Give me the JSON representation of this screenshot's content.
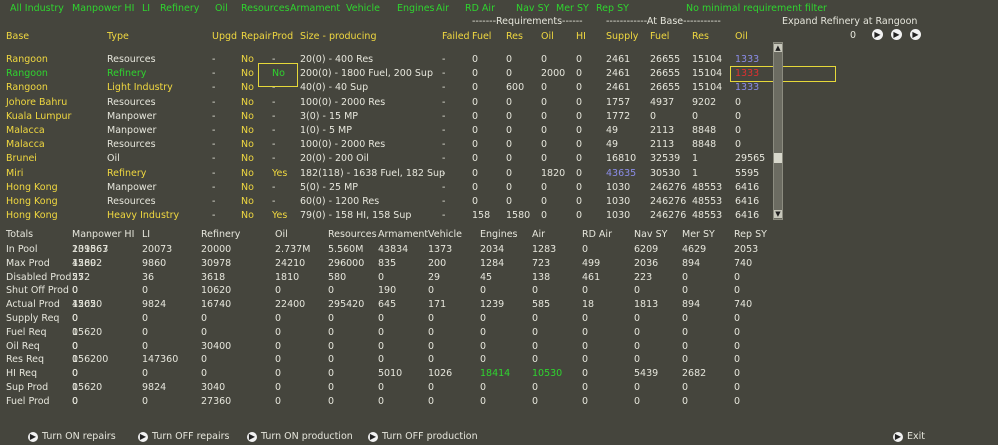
{
  "filters": [
    "All Industry",
    "Manpower HI",
    "LI",
    "Refinery",
    "Oil",
    "Resources",
    "Armament",
    "Vehicle",
    "Engines",
    "Air",
    "RD Air",
    "Nav SY",
    "Mer SY",
    "Rep SY"
  ],
  "filter_note": "No minimal requirement filter",
  "requirements_group": "-------Requirements------",
  "atbase_group": "------------At Base-----------",
  "expand_label": "Expand Refinery at Rangoon",
  "expand_value": "0",
  "columns": [
    "Base",
    "Type",
    "Upgd",
    "Repair",
    "Prod",
    "Size - producing",
    "Failed",
    "Fuel",
    "Res",
    "Oil",
    "HI",
    "Supply",
    "Fuel",
    "Res",
    "Oil"
  ],
  "rows": [
    {
      "base": "Rangoon",
      "type": "Resources",
      "upgd": "-",
      "repair": "No",
      "prod": "-",
      "size": "20(0) - 400 Res",
      "failed": "-",
      "fuel": "0",
      "res": "0",
      "oil": "0",
      "hi": "0",
      "supply": "2461",
      "abfuel": "26655",
      "abres": "15104",
      "aboil": "1333",
      "cb": "yel",
      "ct": "wht",
      "cr": "yel",
      "cp": "wht",
      "cs": "blu"
    },
    {
      "base": "Rangoon",
      "type": "Refinery",
      "upgd": "-",
      "repair": "No",
      "prod": "No",
      "size": "200(0) - 1800 Fuel, 200 Sup",
      "failed": "-",
      "fuel": "0",
      "res": "0",
      "oil": "2000",
      "hi": "0",
      "supply": "2461",
      "abfuel": "26655",
      "abres": "15104",
      "aboil": "1333",
      "cb": "grn",
      "ct": "grn",
      "cr": "yel",
      "cp": "grn",
      "cs": "red"
    },
    {
      "base": "Rangoon",
      "type": "Light Industry",
      "upgd": "-",
      "repair": "No",
      "prod": "-",
      "size": "40(0) - 40 Sup",
      "failed": "-",
      "fuel": "0",
      "res": "600",
      "oil": "0",
      "hi": "0",
      "supply": "2461",
      "abfuel": "26655",
      "abres": "15104",
      "aboil": "1333",
      "cb": "yel",
      "ct": "yel",
      "cr": "yel",
      "cp": "wht",
      "cs": "blu"
    },
    {
      "base": "Johore Bahru",
      "type": "Resources",
      "upgd": "-",
      "repair": "No",
      "prod": "-",
      "size": "100(0) - 2000 Res",
      "failed": "-",
      "fuel": "0",
      "res": "0",
      "oil": "0",
      "hi": "0",
      "supply": "1757",
      "abfuel": "4937",
      "abres": "9202",
      "aboil": "0",
      "cb": "yel",
      "ct": "wht",
      "cr": "yel",
      "cp": "wht",
      "cs": "wht"
    },
    {
      "base": "Kuala Lumpur",
      "type": "Manpower",
      "upgd": "-",
      "repair": "No",
      "prod": "-",
      "size": "3(0) - 15 MP",
      "failed": "-",
      "fuel": "0",
      "res": "0",
      "oil": "0",
      "hi": "0",
      "supply": "1772",
      "abfuel": "0",
      "abres": "0",
      "aboil": "0",
      "cb": "yel",
      "ct": "wht",
      "cr": "yel",
      "cp": "wht",
      "cs": "wht"
    },
    {
      "base": "Malacca",
      "type": "Manpower",
      "upgd": "-",
      "repair": "No",
      "prod": "-",
      "size": "1(0) - 5 MP",
      "failed": "-",
      "fuel": "0",
      "res": "0",
      "oil": "0",
      "hi": "0",
      "supply": "49",
      "abfuel": "2113",
      "abres": "8848",
      "aboil": "0",
      "cb": "yel",
      "ct": "wht",
      "cr": "yel",
      "cp": "wht",
      "cs": "wht"
    },
    {
      "base": "Malacca",
      "type": "Resources",
      "upgd": "-",
      "repair": "No",
      "prod": "-",
      "size": "100(0) - 2000 Res",
      "failed": "-",
      "fuel": "0",
      "res": "0",
      "oil": "0",
      "hi": "0",
      "supply": "49",
      "abfuel": "2113",
      "abres": "8848",
      "aboil": "0",
      "cb": "yel",
      "ct": "wht",
      "cr": "yel",
      "cp": "wht",
      "cs": "wht"
    },
    {
      "base": "Brunei",
      "type": "Oil",
      "upgd": "-",
      "repair": "No",
      "prod": "-",
      "size": "20(0) - 200 Oil",
      "failed": "-",
      "fuel": "0",
      "res": "0",
      "oil": "0",
      "hi": "0",
      "supply": "16810",
      "abfuel": "32539",
      "abres": "1",
      "aboil": "29565",
      "cb": "yel",
      "ct": "wht",
      "cr": "yel",
      "cp": "wht",
      "cs": "wht"
    },
    {
      "base": "Miri",
      "type": "Refinery",
      "upgd": "-",
      "repair": "No",
      "prod": "Yes",
      "size": "182(118) - 1638 Fuel, 182 Sup",
      "failed": "-",
      "fuel": "0",
      "res": "0",
      "oil": "1820",
      "hi": "0",
      "supply": "43635",
      "abfuel": "30530",
      "abres": "1",
      "aboil": "5595",
      "cb": "yel",
      "ct": "yel",
      "cr": "yel",
      "cp": "yel",
      "cs": "wht",
      "csup": "blu"
    },
    {
      "base": "Hong Kong",
      "type": "Manpower",
      "upgd": "-",
      "repair": "No",
      "prod": "-",
      "size": "5(0) - 25 MP",
      "failed": "-",
      "fuel": "0",
      "res": "0",
      "oil": "0",
      "hi": "0",
      "supply": "1030",
      "abfuel": "246276",
      "abres": "48553",
      "aboil": "6416",
      "cb": "yel",
      "ct": "wht",
      "cr": "yel",
      "cp": "wht",
      "cs": "wht"
    },
    {
      "base": "Hong Kong",
      "type": "Resources",
      "upgd": "-",
      "repair": "No",
      "prod": "-",
      "size": "60(0) - 1200 Res",
      "failed": "-",
      "fuel": "0",
      "res": "0",
      "oil": "0",
      "hi": "0",
      "supply": "1030",
      "abfuel": "246276",
      "abres": "48553",
      "aboil": "6416",
      "cb": "yel",
      "ct": "wht",
      "cr": "yel",
      "cp": "wht",
      "cs": "wht"
    },
    {
      "base": "Hong Kong",
      "type": "Heavy Industry",
      "upgd": "-",
      "repair": "No",
      "prod": "Yes",
      "size": "79(0) - 158 HI, 158 Sup",
      "failed": "-",
      "fuel": "158",
      "res": "1580",
      "oil": "0",
      "hi": "0",
      "supply": "1030",
      "abfuel": "246276",
      "abres": "48553",
      "aboil": "6416",
      "cb": "yel",
      "ct": "yel",
      "cr": "yel",
      "cp": "yel",
      "cs": "wht"
    }
  ],
  "totals_header": [
    "Totals",
    "Manpower HI",
    "LI",
    "Refinery",
    "Oil",
    "Resources",
    "Armament",
    "Vehicle",
    "Engines",
    "Air",
    "RD Air",
    "Nav SY",
    "Mer SY",
    "Rep SY"
  ],
  "totals": [
    {
      "label": "In Pool",
      "v": [
        "231863",
        "109567",
        "20073",
        "20000",
        "2.737M",
        "5.560M",
        "43834",
        "1373",
        "2034",
        "1283",
        "0",
        "6209",
        "4629",
        "2053"
      ]
    },
    {
      "label": "Max Prod",
      "v": [
        "4260",
        "15892",
        "9860",
        "30978",
        "24210",
        "296000",
        "835",
        "200",
        "1284",
        "723",
        "499",
        "2036",
        "894",
        "740"
      ]
    },
    {
      "label": "Disabled Prod",
      "v": [
        "55",
        "272",
        "36",
        "3618",
        "1810",
        "580",
        "0",
        "29",
        "45",
        "138",
        "461",
        "223",
        "0",
        "0"
      ]
    },
    {
      "label": "Shut Off Prod",
      "v": [
        "0",
        "0",
        "0",
        "10620",
        "0",
        "0",
        "190",
        "0",
        "0",
        "0",
        "0",
        "0",
        "0",
        "0"
      ]
    },
    {
      "label": "Actual Prod",
      "v": [
        "4205",
        "15620",
        "9824",
        "16740",
        "22400",
        "295420",
        "645",
        "171",
        "1239",
        "585",
        "18",
        "1813",
        "894",
        "740"
      ]
    },
    {
      "label": "Supply Req",
      "v": [
        "0",
        "0",
        "0",
        "0",
        "0",
        "0",
        "0",
        "0",
        "0",
        "0",
        "0",
        "0",
        "0",
        "0"
      ]
    },
    {
      "label": "Fuel Req",
      "v": [
        "0",
        "15620",
        "0",
        "0",
        "0",
        "0",
        "0",
        "0",
        "0",
        "0",
        "0",
        "0",
        "0",
        "0"
      ]
    },
    {
      "label": "Oil Req",
      "v": [
        "0",
        "0",
        "0",
        "30400",
        "0",
        "0",
        "0",
        "0",
        "0",
        "0",
        "0",
        "0",
        "0",
        "0"
      ]
    },
    {
      "label": "Res Req",
      "v": [
        "0",
        "156200",
        "147360",
        "0",
        "0",
        "0",
        "0",
        "0",
        "0",
        "0",
        "0",
        "0",
        "0",
        "0"
      ]
    },
    {
      "label": "HI Req",
      "v": [
        "0",
        "0",
        "0",
        "0",
        "0",
        "0",
        "5010",
        "1026",
        "18414",
        "10530",
        "0",
        "5439",
        "2682",
        "0"
      ]
    },
    {
      "label": "Sup Prod",
      "v": [
        "0",
        "15620",
        "9824",
        "3040",
        "0",
        "0",
        "0",
        "0",
        "0",
        "0",
        "0",
        "0",
        "0",
        "0"
      ]
    },
    {
      "label": "Fuel Prod",
      "v": [
        "0",
        "0",
        "0",
        "27360",
        "0",
        "0",
        "0",
        "0",
        "0",
        "0",
        "0",
        "0",
        "0",
        "0"
      ]
    }
  ],
  "buttons": [
    "Turn ON repairs",
    "Turn OFF repairs",
    "Turn ON production",
    "Turn OFF production"
  ],
  "exit_label": "Exit",
  "colors": {
    "background": "#45453d",
    "yellow": "#f0d840",
    "green": "#2fd42f",
    "white": "#e6e6dc",
    "blue": "#8a8ce6",
    "red": "#e03030"
  }
}
